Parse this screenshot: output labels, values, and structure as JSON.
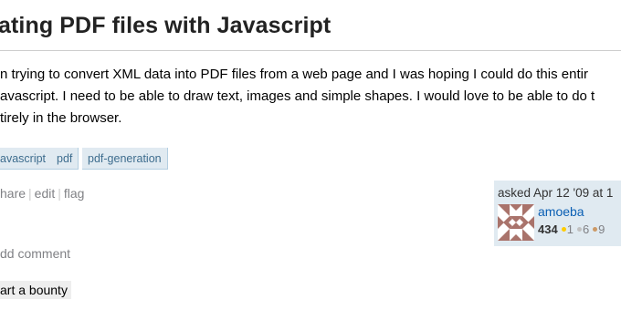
{
  "question": {
    "title": "ating PDF files with Javascript",
    "body_lines": [
      "n trying to convert XML data into PDF files from a web page and I was hoping I could do this entir",
      "avascript. I need to be able to draw text, images and simple shapes. I would love to be able to do t",
      "tirely in the browser."
    ],
    "tags": [
      "avascript",
      "pdf",
      "pdf-generation"
    ]
  },
  "actions": {
    "share": "hare",
    "edit": "edit",
    "flag": "flag",
    "separator": "|"
  },
  "owner": {
    "asked": "asked Apr 12 '09 at 1",
    "user_name": "amoeba",
    "reputation": "434",
    "gold": "1",
    "silver": "6",
    "bronze": "9",
    "gold_color": "#ffcc01",
    "silver_color": "#c0c0c0",
    "bronze_color": "#cc9966",
    "avatar_icon": "identicon"
  },
  "comments": {
    "add_comment": "dd comment"
  },
  "bounty": {
    "label": "art a bounty"
  }
}
